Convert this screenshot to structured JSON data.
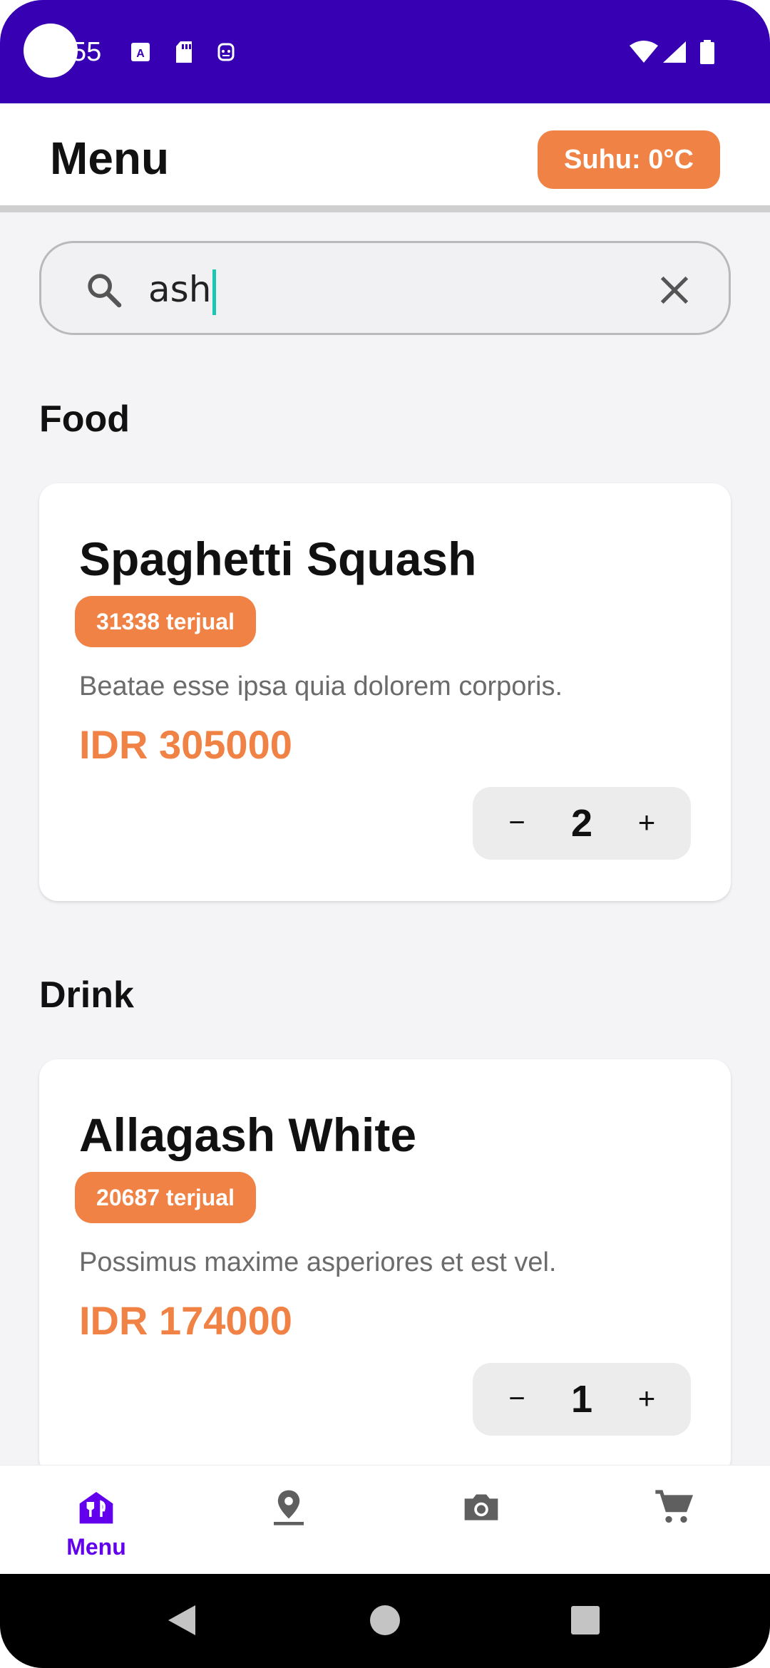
{
  "status_bar": {
    "time": "55"
  },
  "app_bar": {
    "title": "Menu",
    "temperature": "Suhu: 0°C"
  },
  "search": {
    "value": "ash"
  },
  "sections": [
    {
      "title": "Food",
      "items": [
        {
          "name": "Spaghetti Squash",
          "sold": "31338 terjual",
          "description": "Beatae esse ipsa quia dolorem corporis.",
          "price": "IDR 305000",
          "quantity": "2"
        }
      ]
    },
    {
      "title": "Drink",
      "items": [
        {
          "name": "Allagash White",
          "sold": "20687 terjual",
          "description": "Possimus maxime asperiores et est vel.",
          "price": "IDR 174000",
          "quantity": "1"
        }
      ]
    }
  ],
  "stepper": {
    "minus": "−",
    "plus": "+"
  },
  "bottom_nav": {
    "items": [
      {
        "icon": "restaurant-menu-icon",
        "label": "Menu",
        "active": true
      },
      {
        "icon": "location-pin-icon",
        "label": "",
        "active": false
      },
      {
        "icon": "camera-icon",
        "label": "",
        "active": false
      },
      {
        "icon": "cart-icon",
        "label": "",
        "active": false
      }
    ]
  },
  "colors": {
    "accent": "#ef8244",
    "status_bar": "#3700b3",
    "nav_active": "#6200ee",
    "icon_inactive": "#5f5f5f",
    "caret": "#1bc7b1"
  }
}
